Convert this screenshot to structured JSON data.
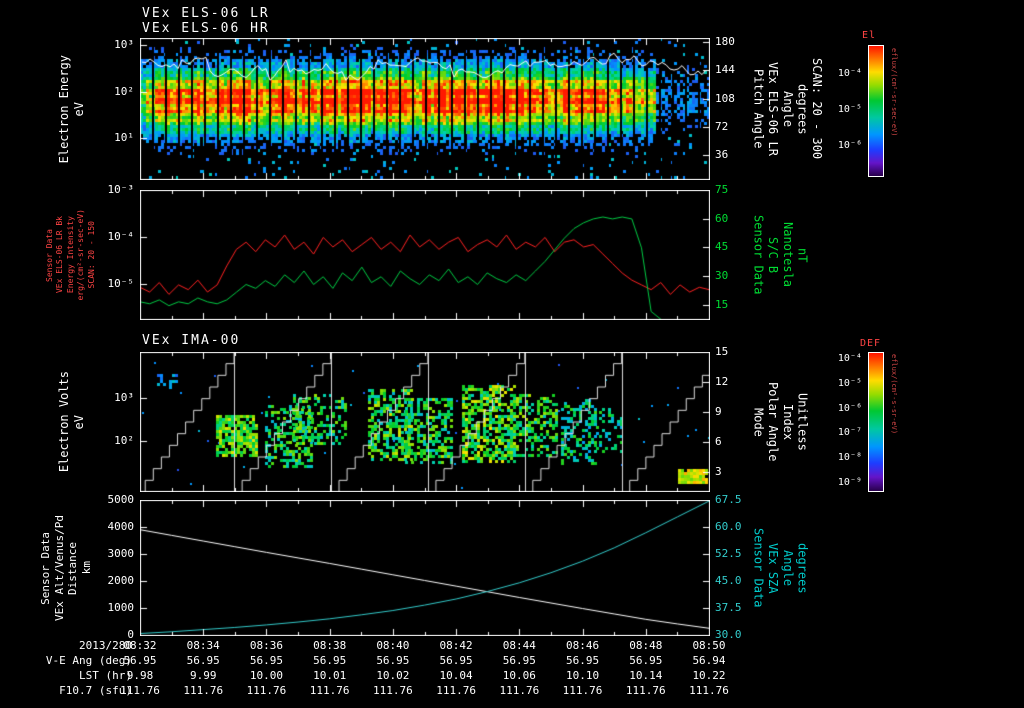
{
  "titles": {
    "panel1_line1": "VEx ELS-06 LR",
    "panel1_line2": "VEx ELS-06 HR",
    "panel3": "VEx IMA-00"
  },
  "colors": {
    "white": "#ffffff",
    "red_line": "#ff2222",
    "red_label": "#ff4444",
    "green": "#00cc44",
    "green_label": "#00dd33",
    "cyan": "#33cccc",
    "cyan_label": "#00cccc"
  },
  "chart_data": [
    {
      "id": "els_spectrogram",
      "type": "heatmap",
      "title": "VEx ELS-06 LR / VEx ELS-06 HR",
      "x_range": [
        "08:32",
        "08:50"
      ],
      "ylabel_lines": [
        "Electron Energy",
        "eV"
      ],
      "yticks": [
        {
          "label": "10³",
          "frac": 0.05
        },
        {
          "label": "10²",
          "frac": 0.38
        },
        {
          "label": "10¹",
          "frac": 0.71
        }
      ],
      "right_label_lines": [
        "Pitch Angle",
        "VEx ELS-06 LR",
        "Angle",
        "degrees",
        "SCAN: 20 - 300"
      ],
      "right_ticks": [
        {
          "label": "180",
          "frac": 0.03
        },
        {
          "label": "144",
          "frac": 0.23
        },
        {
          "label": "108",
          "frac": 0.43
        },
        {
          "label": "72",
          "frac": 0.63
        },
        {
          "label": "36",
          "frac": 0.83
        }
      ],
      "band": {
        "center": 0.42,
        "width": 0.16
      },
      "overlay_line": {
        "mean_frac": 0.2,
        "amp": 0.09,
        "spike_prob": 0.1
      },
      "seed": 7
    },
    {
      "id": "els_intensity_and_b",
      "type": "line",
      "left_label_lines": [
        "Sensor Data",
        "VEx ELS-06 LR Bk",
        "Energy Intensity",
        "erg/(cm²-sr-sec-eV)",
        "SCAN: 20 - 150"
      ],
      "yticks_left": [
        {
          "label": "10⁻³",
          "frac": 0.0
        },
        {
          "label": "10⁻⁴",
          "frac": 0.365
        },
        {
          "label": "10⁻⁵",
          "frac": 0.73
        }
      ],
      "right_label_lines": [
        "Sensor Data",
        "S/C B",
        "Nanotesla",
        "nT"
      ],
      "yticks_right": [
        {
          "label": "75",
          "frac": 0.0
        },
        {
          "label": "60",
          "frac": 0.2225
        },
        {
          "label": "45",
          "frac": 0.445
        },
        {
          "label": "30",
          "frac": 0.6675
        },
        {
          "label": "15",
          "frac": 0.89
        }
      ],
      "right_tick_color": "#00dd33",
      "series": [
        {
          "name": "els_bk_energy_intensity",
          "color": "#ff2222",
          "axis": "log_left",
          "log_top": -3,
          "frac_per_decade": 0.365,
          "values": [
            -5.05,
            -5.15,
            -4.95,
            -5.2,
            -5.0,
            -5.1,
            -4.9,
            -5.15,
            -5.0,
            -4.6,
            -4.25,
            -4.1,
            -4.3,
            -4.05,
            -4.2,
            -3.95,
            -4.25,
            -4.1,
            -4.35,
            -4.0,
            -4.2,
            -4.05,
            -4.3,
            -4.15,
            -4.0,
            -4.25,
            -4.1,
            -4.3,
            -3.95,
            -4.2,
            -4.05,
            -4.25,
            -4.1,
            -4.0,
            -4.3,
            -4.15,
            -4.05,
            -4.2,
            -3.95,
            -4.25,
            -4.1,
            -4.2,
            -4.0,
            -4.3,
            -4.1,
            -4.05,
            -4.2,
            -4.15,
            -4.35,
            -4.55,
            -4.75,
            -4.9,
            -5.0,
            -5.1,
            -4.95,
            -5.2,
            -5.0,
            -5.15,
            -5.05,
            -5.1
          ]
        },
        {
          "name": "sc_b_nanotesla",
          "color": "#00cc44",
          "axis": "right",
          "top_value": 75,
          "bottom_value": 15,
          "bottom_frac": 0.89,
          "values": [
            17,
            16,
            18,
            15,
            17,
            16,
            19,
            17,
            16,
            18,
            22,
            26,
            24,
            28,
            25,
            31,
            27,
            33,
            26,
            30,
            24,
            32,
            28,
            35,
            27,
            30,
            25,
            33,
            29,
            26,
            31,
            28,
            34,
            27,
            30,
            26,
            32,
            29,
            27,
            31,
            28,
            33,
            38,
            44,
            50,
            55,
            58,
            60,
            61,
            60,
            61,
            60,
            45,
            12,
            8,
            6,
            7,
            6,
            6,
            5
          ]
        }
      ]
    },
    {
      "id": "ima_spectrogram",
      "type": "heatmap",
      "title": "VEx IMA-00",
      "ylabel_lines": [
        "Electron Volts",
        "eV"
      ],
      "yticks": [
        {
          "label": "10³",
          "frac": 0.33
        },
        {
          "label": "10²",
          "frac": 0.64
        }
      ],
      "right_label_lines": [
        "Mode",
        "Polar Angle",
        "Index",
        "Unitless"
      ],
      "right_ticks": [
        {
          "label": "15",
          "frac": 0.0
        },
        {
          "label": "12",
          "frac": 0.215
        },
        {
          "label": "9",
          "frac": 0.43
        },
        {
          "label": "6",
          "frac": 0.645
        },
        {
          "label": "3",
          "frac": 0.86
        }
      ],
      "blobs": [
        {
          "x0": 0.03,
          "x1": 0.065,
          "y0": 0.16,
          "y1": 0.25,
          "density": 0.35,
          "v": [
            0.2,
            0.38
          ]
        },
        {
          "x0": 0.135,
          "x1": 0.205,
          "y0": 0.45,
          "y1": 0.73,
          "density": 0.75,
          "v": [
            0.45,
            0.78
          ]
        },
        {
          "x0": 0.22,
          "x1": 0.3,
          "y0": 0.38,
          "y1": 0.82,
          "density": 0.45,
          "v": [
            0.35,
            0.68
          ]
        },
        {
          "x0": 0.27,
          "x1": 0.36,
          "y0": 0.3,
          "y1": 0.66,
          "density": 0.4,
          "v": [
            0.35,
            0.7
          ]
        },
        {
          "x0": 0.4,
          "x1": 0.475,
          "y0": 0.27,
          "y1": 0.78,
          "density": 0.55,
          "v": [
            0.35,
            0.75
          ]
        },
        {
          "x0": 0.465,
          "x1": 0.545,
          "y0": 0.33,
          "y1": 0.8,
          "density": 0.5,
          "v": [
            0.35,
            0.72
          ]
        },
        {
          "x0": 0.565,
          "x1": 0.655,
          "y0": 0.24,
          "y1": 0.78,
          "density": 0.62,
          "v": [
            0.4,
            0.8
          ]
        },
        {
          "x0": 0.645,
          "x1": 0.73,
          "y0": 0.3,
          "y1": 0.74,
          "density": 0.5,
          "v": [
            0.38,
            0.72
          ]
        },
        {
          "x0": 0.74,
          "x1": 0.8,
          "y0": 0.34,
          "y1": 0.8,
          "density": 0.42,
          "v": [
            0.3,
            0.62
          ]
        },
        {
          "x0": 0.8,
          "x1": 0.845,
          "y0": 0.4,
          "y1": 0.72,
          "density": 0.35,
          "v": [
            0.3,
            0.6
          ]
        },
        {
          "x0": 0.945,
          "x1": 0.995,
          "y0": 0.84,
          "y1": 0.93,
          "density": 0.9,
          "v": [
            0.62,
            0.85
          ]
        }
      ],
      "ramps": {
        "first_top_frac": 0.165,
        "period": 0.17,
        "steps": 12
      },
      "scatter_count": 110,
      "seed": 11
    },
    {
      "id": "altitude_and_sza",
      "type": "line",
      "left_label_lines": [
        "Sensor Data",
        "VEx Alt/Venus/Pd",
        "Distance",
        "km"
      ],
      "yticks_left": [
        {
          "label": "5000",
          "frac": 0.0
        },
        {
          "label": "4000",
          "frac": 0.2
        },
        {
          "label": "3000",
          "frac": 0.4
        },
        {
          "label": "2000",
          "frac": 0.6
        },
        {
          "label": "1000",
          "frac": 0.8
        },
        {
          "label": "0",
          "frac": 1.0
        }
      ],
      "right_label_lines": [
        "Sensor Data",
        "VEx SZA",
        "Angle",
        "degrees"
      ],
      "yticks_right": [
        {
          "label": "67.5",
          "frac": 0.0
        },
        {
          "label": "60.0",
          "frac": 0.2
        },
        {
          "label": "52.5",
          "frac": 0.4
        },
        {
          "label": "45.0",
          "frac": 0.6
        },
        {
          "label": "37.5",
          "frac": 0.8
        },
        {
          "label": "30.0",
          "frac": 1.0
        }
      ],
      "right_tick_color": "#33cccc",
      "series": [
        {
          "name": "vex_altitude_km",
          "color": "#ffffff",
          "axis": "left",
          "min": 0,
          "max": 5000,
          "values": [
            3900,
            3690,
            3480,
            3270,
            3060,
            2855,
            2650,
            2440,
            2230,
            2020,
            1810,
            1600,
            1390,
            1185,
            980,
            780,
            580,
            410,
            250
          ]
        },
        {
          "name": "vex_sza_deg",
          "color": "#33cccc",
          "axis": "right",
          "min": 30,
          "max": 67.5,
          "values": [
            30.4,
            30.9,
            31.5,
            32.1,
            32.8,
            33.6,
            34.5,
            35.6,
            36.8,
            38.3,
            40.0,
            42.1,
            44.5,
            47.3,
            50.5,
            54.2,
            58.4,
            62.8,
            67.2
          ]
        }
      ]
    }
  ],
  "colorbars": [
    {
      "title": "El",
      "title_color": "#ff4444",
      "side_text": "eflux/(cm²-sr-sec-eV)",
      "ticks": [
        {
          "label": "10⁻⁴",
          "frac": 0.22
        },
        {
          "label": "10⁻⁵",
          "frac": 0.5
        },
        {
          "label": "10⁻⁶",
          "frac": 0.78
        }
      ],
      "stops": [
        {
          "p": 0,
          "c": "#ff1400"
        },
        {
          "p": 0.1,
          "c": "#ff7800"
        },
        {
          "p": 0.2,
          "c": "#ffdc00"
        },
        {
          "p": 0.3,
          "c": "#96dc00"
        },
        {
          "p": 0.42,
          "c": "#00c832"
        },
        {
          "p": 0.55,
          "c": "#00c8a0"
        },
        {
          "p": 0.68,
          "c": "#0096ff"
        },
        {
          "p": 0.8,
          "c": "#1e3cff"
        },
        {
          "p": 0.9,
          "c": "#6414c8"
        },
        {
          "p": 1,
          "c": "#28004b"
        }
      ]
    },
    {
      "title": "DEF",
      "title_color": "#ff4444",
      "side_text": "eflux/(cm²-s-sr-eV)",
      "ticks": [
        {
          "label": "10⁻⁴",
          "frac": 0.05
        },
        {
          "label": "10⁻⁵",
          "frac": 0.23
        },
        {
          "label": "10⁻⁶",
          "frac": 0.41
        },
        {
          "label": "10⁻⁷",
          "frac": 0.59
        },
        {
          "label": "10⁻⁸",
          "frac": 0.77
        },
        {
          "label": "10⁻⁹",
          "frac": 0.95
        }
      ],
      "stops": [
        {
          "p": 0,
          "c": "#ff1400"
        },
        {
          "p": 0.1,
          "c": "#ff7800"
        },
        {
          "p": 0.2,
          "c": "#ffdc00"
        },
        {
          "p": 0.3,
          "c": "#96dc00"
        },
        {
          "p": 0.42,
          "c": "#00c832"
        },
        {
          "p": 0.55,
          "c": "#00c8a0"
        },
        {
          "p": 0.68,
          "c": "#0096ff"
        },
        {
          "p": 0.8,
          "c": "#1e3cff"
        },
        {
          "p": 0.9,
          "c": "#6414c8"
        },
        {
          "p": 1,
          "c": "#28004b"
        }
      ]
    }
  ],
  "bottom_axis": {
    "date": "2013/280",
    "times": [
      "08:32",
      "08:34",
      "08:36",
      "08:38",
      "08:40",
      "08:42",
      "08:44",
      "08:46",
      "08:48",
      "08:50"
    ],
    "rows": [
      {
        "label": "V-E Ang (deg)",
        "values": [
          "56.95",
          "56.95",
          "56.95",
          "56.95",
          "56.95",
          "56.95",
          "56.95",
          "56.95",
          "56.95",
          "56.94"
        ]
      },
      {
        "label": "LST (hr)",
        "values": [
          "9.98",
          "9.99",
          "10.00",
          "10.01",
          "10.02",
          "10.04",
          "10.06",
          "10.10",
          "10.14",
          "10.22"
        ]
      },
      {
        "label": "F10.7 (sfu)",
        "values": [
          "111.76",
          "111.76",
          "111.76",
          "111.76",
          "111.76",
          "111.76",
          "111.76",
          "111.76",
          "111.76",
          "111.76"
        ]
      }
    ]
  }
}
